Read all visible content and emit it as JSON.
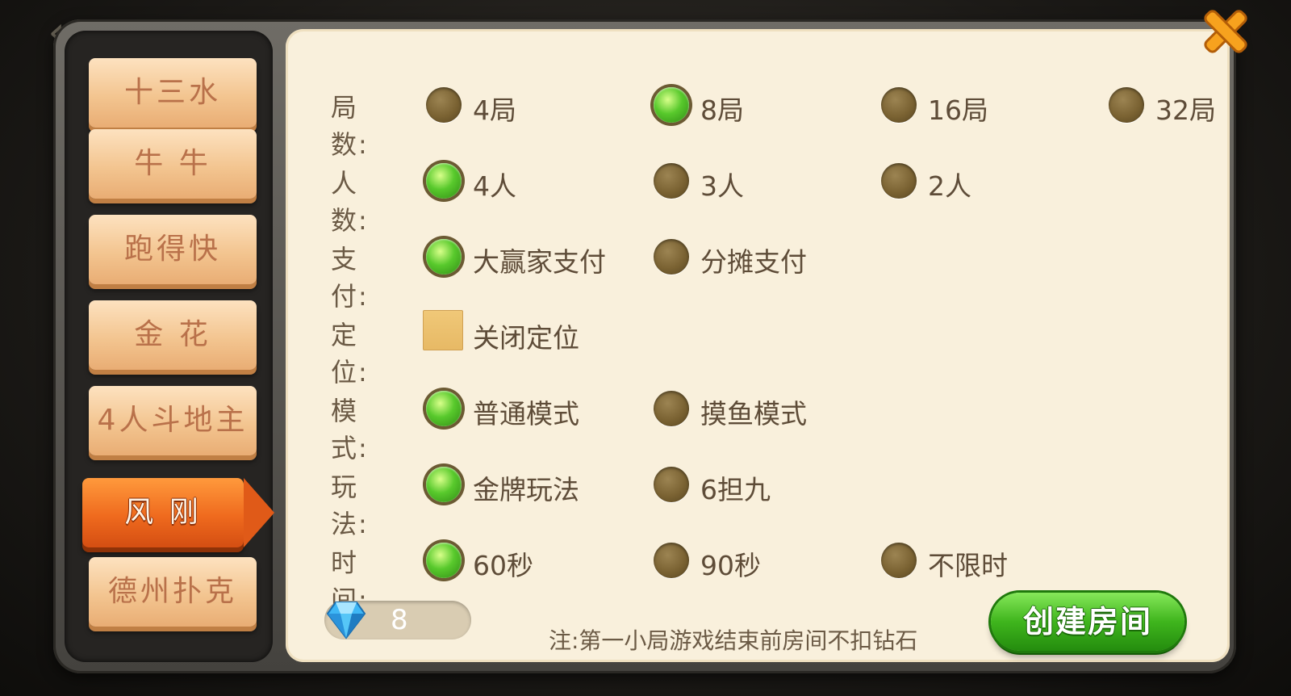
{
  "tabs": [
    {
      "label": "十三水",
      "active": false
    },
    {
      "label": "牛 牛",
      "active": false
    },
    {
      "label": "跑得快",
      "active": false
    },
    {
      "label": "金 花",
      "active": false
    },
    {
      "label": "4人斗地主",
      "active": false
    },
    {
      "label": "风 刚",
      "active": true
    },
    {
      "label": "德州扑克",
      "active": false
    }
  ],
  "settings": {
    "rounds": {
      "label": "局数",
      "options": [
        "4局",
        "8局",
        "16局",
        "32局"
      ],
      "selected": 1
    },
    "players": {
      "label": "人数",
      "options": [
        "4人",
        "3人",
        "2人"
      ],
      "selected": 0
    },
    "payment": {
      "label": "支付",
      "options": [
        "大赢家支付",
        "分摊支付"
      ],
      "selected": 0
    },
    "location": {
      "label": "定位",
      "options": [
        "关闭定位"
      ],
      "checked": false
    },
    "mode": {
      "label": "模式",
      "options": [
        "普通模式",
        "摸鱼模式"
      ],
      "selected": 0
    },
    "rules": {
      "label": "玩法",
      "options": [
        "金牌玩法",
        "6担九"
      ],
      "selected": 0
    },
    "time": {
      "label": "时间",
      "options": [
        "60秒",
        "90秒",
        "不限时"
      ],
      "selected": 0
    }
  },
  "footer": {
    "diamond_count": "8",
    "note": "注:第一小局游戏结束前房间不扣钻石",
    "create_label": "创建房间"
  },
  "icons": {
    "close": "close-icon",
    "diamond": "diamond-icon",
    "back": "back-arrow-icon"
  },
  "colors": {
    "selected": "#4fc226",
    "unselected": "#7a6232",
    "active_tab": "#ef6a1e",
    "create": "#3fb51d"
  }
}
